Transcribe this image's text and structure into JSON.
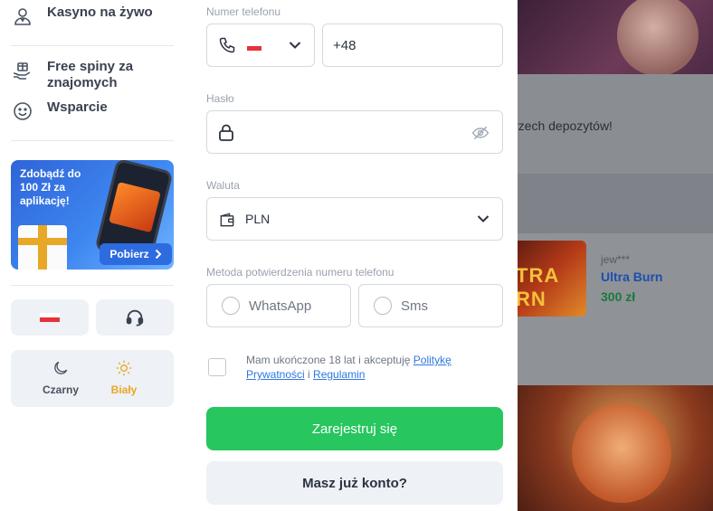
{
  "sidebar": {
    "items": [
      {
        "label": "Kasyno na żywo",
        "icon": "live-dealer-icon"
      },
      {
        "label": "Free spiny za znajomych",
        "icon": "gift-hand-icon"
      },
      {
        "label": "Wsparcie",
        "icon": "smile-icon"
      }
    ],
    "promo": {
      "text": "Zdobądź do 100 Zł za aplikację!",
      "button_label": "Pobierz"
    },
    "theme": {
      "dark_label": "Czarny",
      "light_label": "Biały",
      "active": "light"
    }
  },
  "form": {
    "phone": {
      "label": "Numer telefonu",
      "country_code": "+48"
    },
    "password": {
      "label": "Hasło"
    },
    "currency": {
      "label": "Waluta",
      "value": "PLN"
    },
    "verification": {
      "label": "Metoda potwierdzenia numeru telefonu",
      "options": [
        "WhatsApp",
        "Sms"
      ]
    },
    "consent": {
      "text_prefix": "Mam ukończone 18 lat i akceptuję",
      "privacy_link": "Politykę Prywatności",
      "and": "i",
      "terms_link": "Regulamin"
    },
    "register_button": "Zarejestruj się",
    "login_button": "Masz już konto?"
  },
  "background": {
    "banner_text": "rzech depozytów!",
    "win": {
      "user": "jew***",
      "game": "Ultra Burn",
      "amount": "300 zł",
      "thumb_text": "TRA RN"
    }
  },
  "colors": {
    "primary_green": "#27c65f",
    "link_blue": "#2d78e0",
    "theme_active": "#e8a827"
  }
}
